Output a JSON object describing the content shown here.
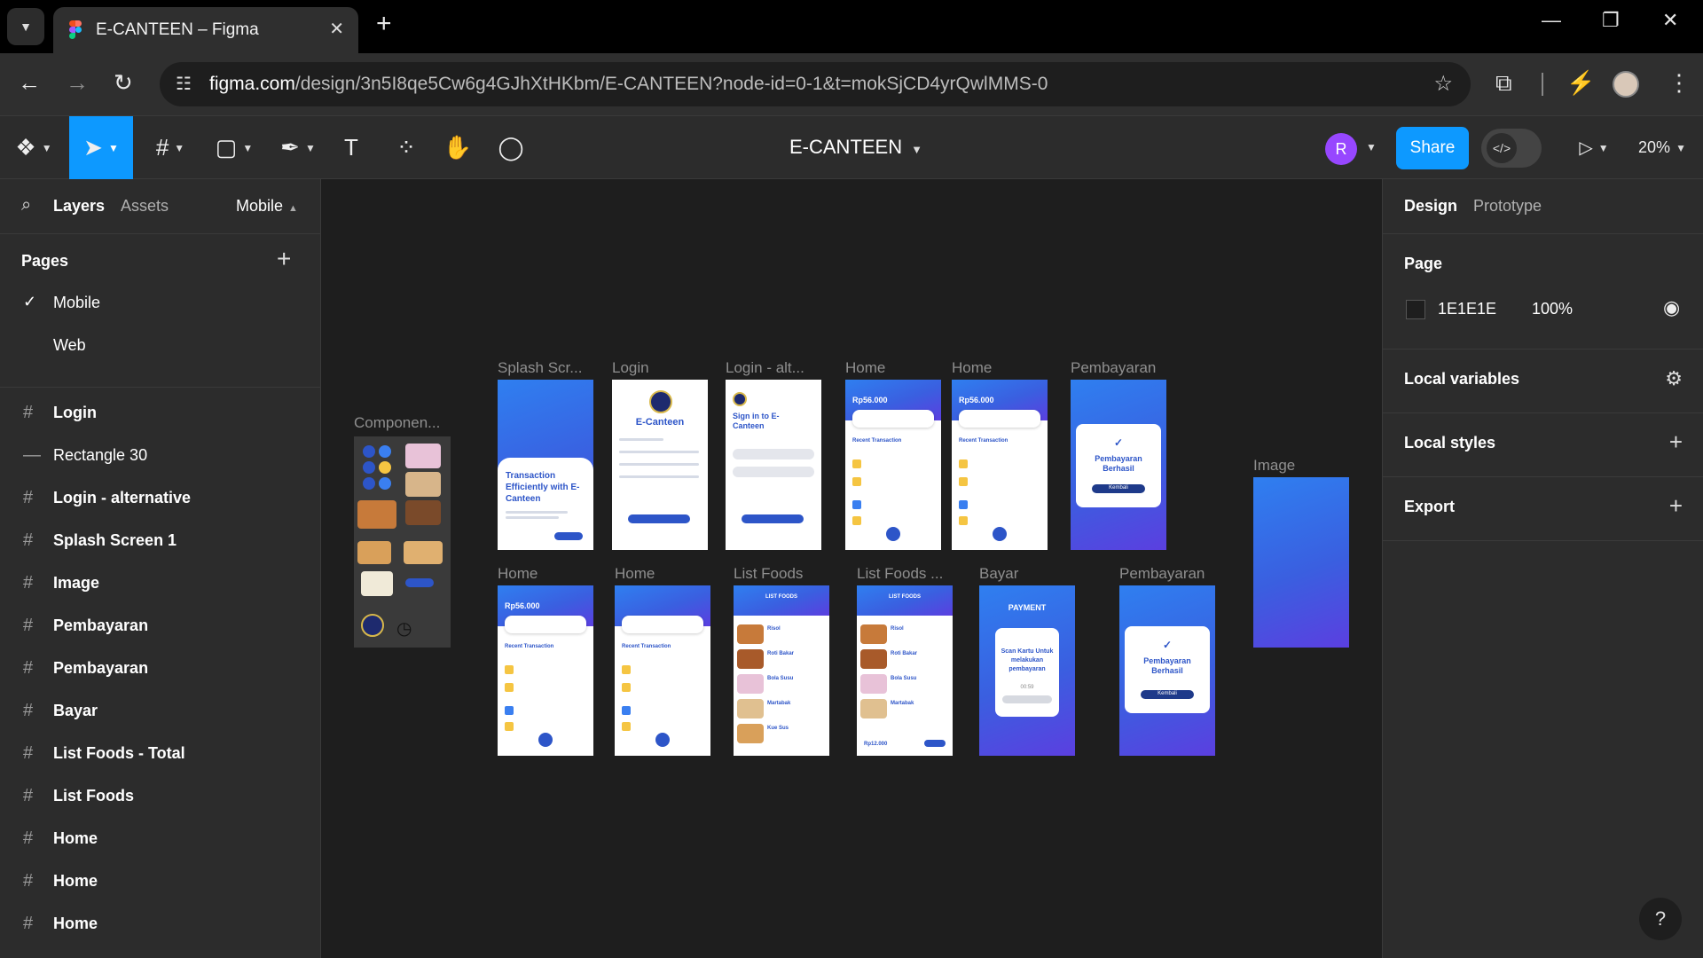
{
  "browser": {
    "tab_title": "E-CANTEEN – Figma",
    "url_host": "figma.com",
    "url_path": "/design/3n5I8qe5Cw6g4GJhXtHKbm/E-CANTEEN?node-id=0-1&t=mokSjCD4yrQwlMMS-0"
  },
  "toolbar": {
    "file_title": "E-CANTEEN",
    "avatar_initial": "R",
    "share_label": "Share",
    "zoom": "20%"
  },
  "left_panel": {
    "tab_layers": "Layers",
    "tab_assets": "Assets",
    "page_switcher": "Mobile",
    "pages_heading": "Pages",
    "pages": [
      "Mobile",
      "Web"
    ],
    "layers": [
      "Login",
      "Rectangle 30",
      "Login - alternative",
      "Splash Screen 1",
      "Image",
      "Pembayaran",
      "Pembayaran",
      "Bayar",
      "List Foods - Total",
      "List Foods",
      "Home",
      "Home",
      "Home"
    ]
  },
  "right_panel": {
    "tab_design": "Design",
    "tab_prototype": "Prototype",
    "page_heading": "Page",
    "page_color": "1E1E1E",
    "page_opacity": "100%",
    "local_variables": "Local variables",
    "local_styles": "Local styles",
    "export": "Export"
  },
  "canvas": {
    "frame_labels": [
      "Componen...",
      "Splash Scr...",
      "Login",
      "Login - alt...",
      "Home",
      "Home",
      "Pembayaran",
      "Image",
      "Home",
      "Home",
      "List Foods",
      "List Foods ...",
      "Bayar",
      "Pembayaran"
    ],
    "splash_text": "Transaction Efficiently with E-Canteen",
    "login_title": "E-Canteen",
    "login_alt_title": "Sign in to E-Canteen",
    "home_balance": "Rp56.000",
    "home_section": "Recent Transaction",
    "payment_success": "Pembayaran Berhasil",
    "payment_back": "Kembali",
    "list_header": "LIST FOODS",
    "foods": [
      "Risol",
      "Roti Bakar",
      "Bola Susu",
      "Martabak",
      "Kue Sus"
    ],
    "list_total": "Rp12.000",
    "bayar_header": "PAYMENT",
    "bayar_text": "Scan Kartu Untuk melakukan pembayaran",
    "bayar_timer": "00:59"
  },
  "colors": {
    "accent": "#0d99ff",
    "avatar": "#9747ff",
    "canvas_bg": "#1e1e1e",
    "panel_bg": "#2c2c2c"
  }
}
